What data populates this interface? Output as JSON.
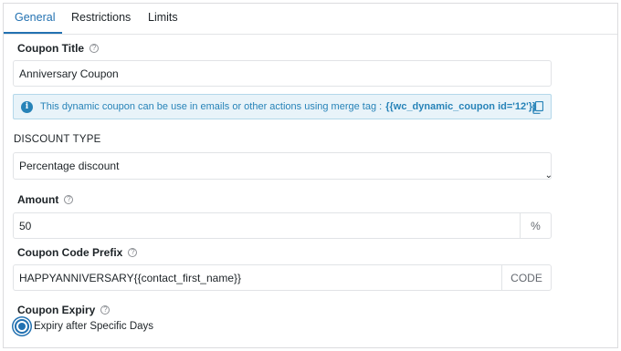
{
  "tabs": [
    {
      "label": "General",
      "active": true
    },
    {
      "label": "Restrictions",
      "active": false
    },
    {
      "label": "Limits",
      "active": false
    }
  ],
  "coupon_title": {
    "label": "Coupon Title",
    "value": "Anniversary Coupon"
  },
  "notice": {
    "text": "This dynamic coupon can be use in emails or other actions using merge tag :",
    "merge_tag": "{{wc_dynamic_coupon id='12'}}",
    "icon": "info-icon",
    "copy_icon": "copy-icon"
  },
  "discount_type": {
    "heading": "DISCOUNT TYPE",
    "selected": "Percentage discount"
  },
  "amount": {
    "label": "Amount",
    "value": "50",
    "suffix": "%"
  },
  "coupon_code_prefix": {
    "label": "Coupon Code Prefix",
    "value": "HAPPYANNIVERSARY{{contact_first_name}}",
    "suffix": "CODE"
  },
  "coupon_expiry": {
    "label": "Coupon Expiry",
    "option_label": "Expiry after Specific Days",
    "selected": true
  },
  "help_glyph": "?",
  "info_glyph": "i",
  "chevron_glyph": "⌄",
  "colors": {
    "accent": "#2271b1",
    "notice_bg": "#e8f3f9",
    "notice_text": "#2783b8",
    "border": "#e1e3e6"
  }
}
